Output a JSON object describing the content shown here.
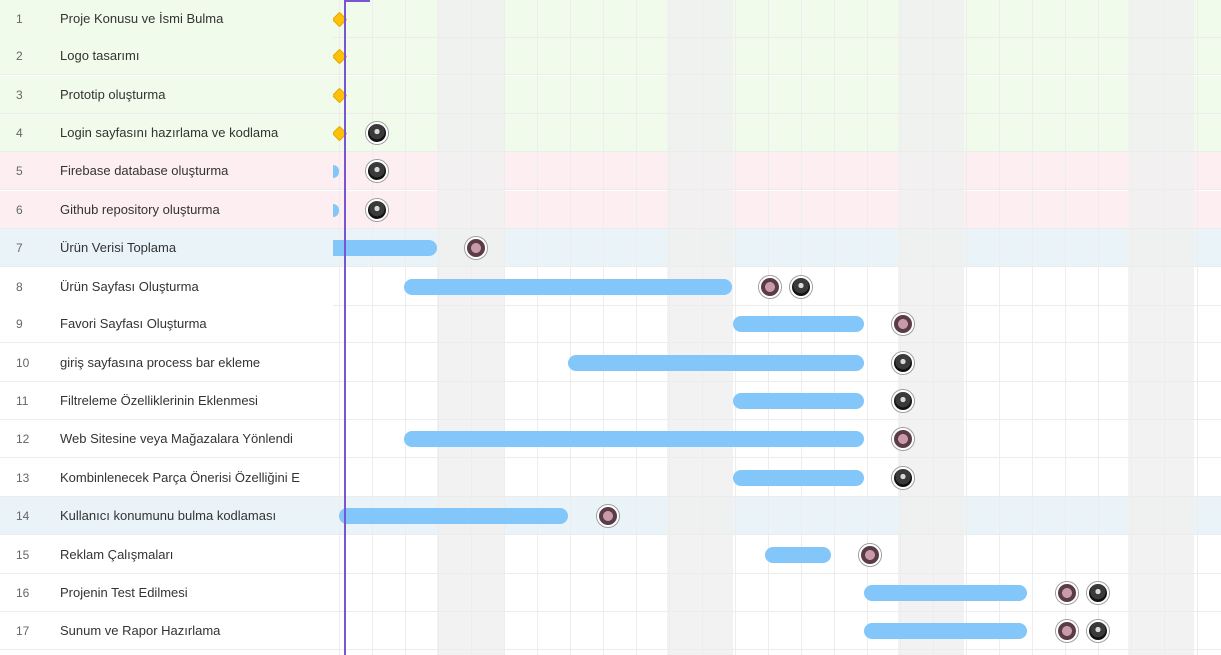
{
  "colors": {
    "row_green": "#f0fbeb",
    "row_pink": "#fdeff1",
    "row_blue": "#e9f3f8",
    "weekend": "#f0f0f0",
    "bar": "#82c6fa",
    "milestone": "#ffc107",
    "today_line": "#7a55d3"
  },
  "tasks": [
    {
      "num": "1",
      "name": "Proje Konusu ve İsmi Bulma",
      "group": "green",
      "marker": "milestone",
      "avatars": []
    },
    {
      "num": "2",
      "name": "Logo tasarımı",
      "group": "green",
      "marker": "milestone",
      "avatars": []
    },
    {
      "num": "3",
      "name": "Prototip oluşturma",
      "group": "green",
      "marker": "milestone",
      "avatars": []
    },
    {
      "num": "4",
      "name": "Login sayfasını hazırlama ve kodlama",
      "group": "green",
      "marker": "milestone",
      "avatars": [
        "dark"
      ]
    },
    {
      "num": "5",
      "name": "Firebase database oluşturma",
      "group": "pink",
      "marker": "half",
      "avatars": [
        "dark"
      ]
    },
    {
      "num": "6",
      "name": "Github repository oluşturma",
      "group": "pink",
      "marker": "half",
      "avatars": [
        "dark"
      ]
    },
    {
      "num": "7",
      "name": "Ürün Verisi Toplama",
      "group": "blue",
      "marker": "bar",
      "avatars": [
        "pink"
      ]
    },
    {
      "num": "8",
      "name": "Ürün Sayfası Oluşturma",
      "group": "white",
      "marker": "bar",
      "avatars": [
        "pink",
        "dark"
      ]
    },
    {
      "num": "9",
      "name": "Favori Sayfası Oluşturma",
      "group": "white",
      "marker": "bar",
      "avatars": [
        "pink"
      ]
    },
    {
      "num": "10",
      "name": "giriş sayfasına process bar ekleme",
      "group": "white",
      "marker": "bar",
      "avatars": [
        "dark"
      ]
    },
    {
      "num": "11",
      "name": "Filtreleme Özelliklerinin Eklenmesi",
      "group": "white",
      "marker": "bar",
      "avatars": [
        "dark"
      ]
    },
    {
      "num": "12",
      "name": "Web Sitesine veya Mağazalara Yönlendi",
      "group": "white",
      "marker": "bar",
      "avatars": [
        "pink"
      ]
    },
    {
      "num": "13",
      "name": "Kombinlenecek Parça Önerisi Özelliğini E",
      "group": "white",
      "marker": "bar",
      "avatars": [
        "dark"
      ]
    },
    {
      "num": "14",
      "name": "Kullanıcı konumunu bulma kodlaması",
      "group": "blue",
      "marker": "bar",
      "avatars": [
        "pink"
      ]
    },
    {
      "num": "15",
      "name": "Reklam Çalışmaları",
      "group": "white",
      "marker": "bar",
      "avatars": [
        "pink"
      ]
    },
    {
      "num": "16",
      "name": "Projenin Test Edilmesi",
      "group": "white",
      "marker": "bar",
      "avatars": [
        "pink",
        "dark"
      ]
    },
    {
      "num": "17",
      "name": "Sunum ve Rapor Hazırlama",
      "group": "white",
      "marker": "bar",
      "avatars": [
        "pink",
        "dark"
      ]
    }
  ]
}
